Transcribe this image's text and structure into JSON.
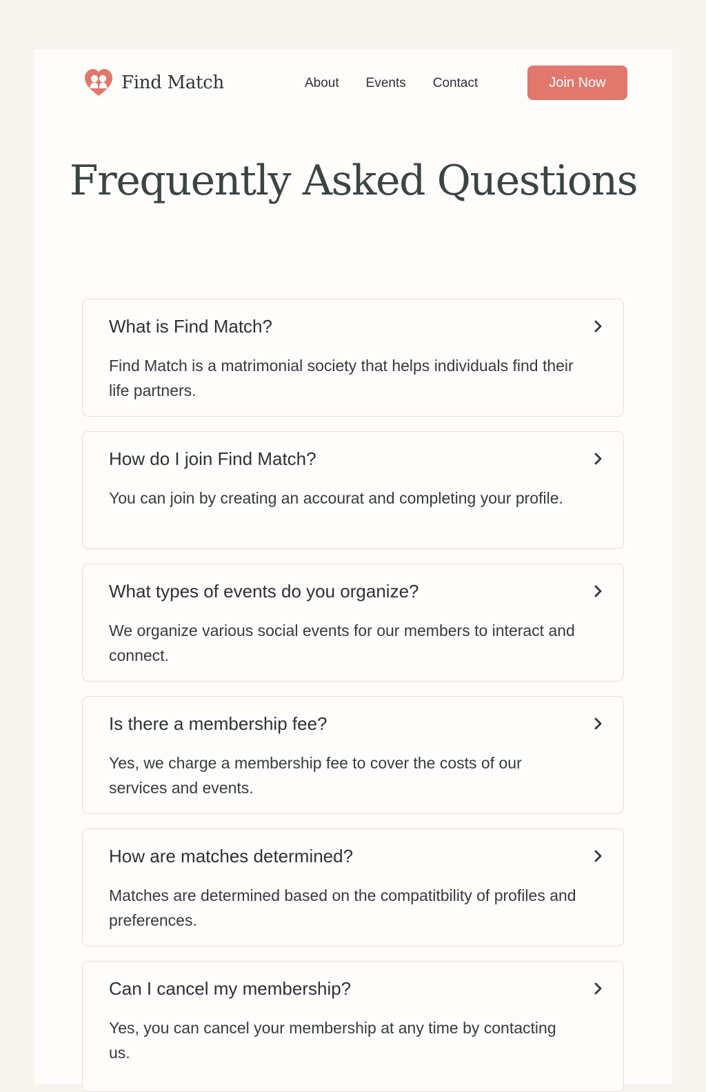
{
  "header": {
    "logo_text": "Find Match",
    "nav": [
      "About",
      "Events",
      "Contact"
    ],
    "cta_label": "Join Now"
  },
  "main": {
    "title": "Frequently Asked Questions",
    "faqs": [
      {
        "question": "What is Find Match?",
        "answer": "Find Match is a matrimonial society that helps individuals find their life partners."
      },
      {
        "question": "How do I join Find Match?",
        "answer": "You can join by creating an accourat and completing your profile."
      },
      {
        "question": "What types of events do you organize?",
        "answer": "We organize various social events for our members to interact and connect."
      },
      {
        "question": "Is there a membership fee?",
        "answer": "Yes, we charge a membership fee to cover the costs of our services and events."
      },
      {
        "question": "How are matches determined?",
        "answer": "Matches are determined based on the compatitbility of profiles and preferences."
      },
      {
        "question": "Can I cancel my membership?",
        "answer": "Yes, you can cancel your membership at any time by contacting us."
      }
    ]
  },
  "icons": {
    "logo": "heart-couple-icon",
    "expand": "chevron-right-icon"
  },
  "colors": {
    "accent": "#e0786e",
    "background": "#f8f5ef",
    "card": "#fefdfb",
    "text": "#2f3435"
  }
}
